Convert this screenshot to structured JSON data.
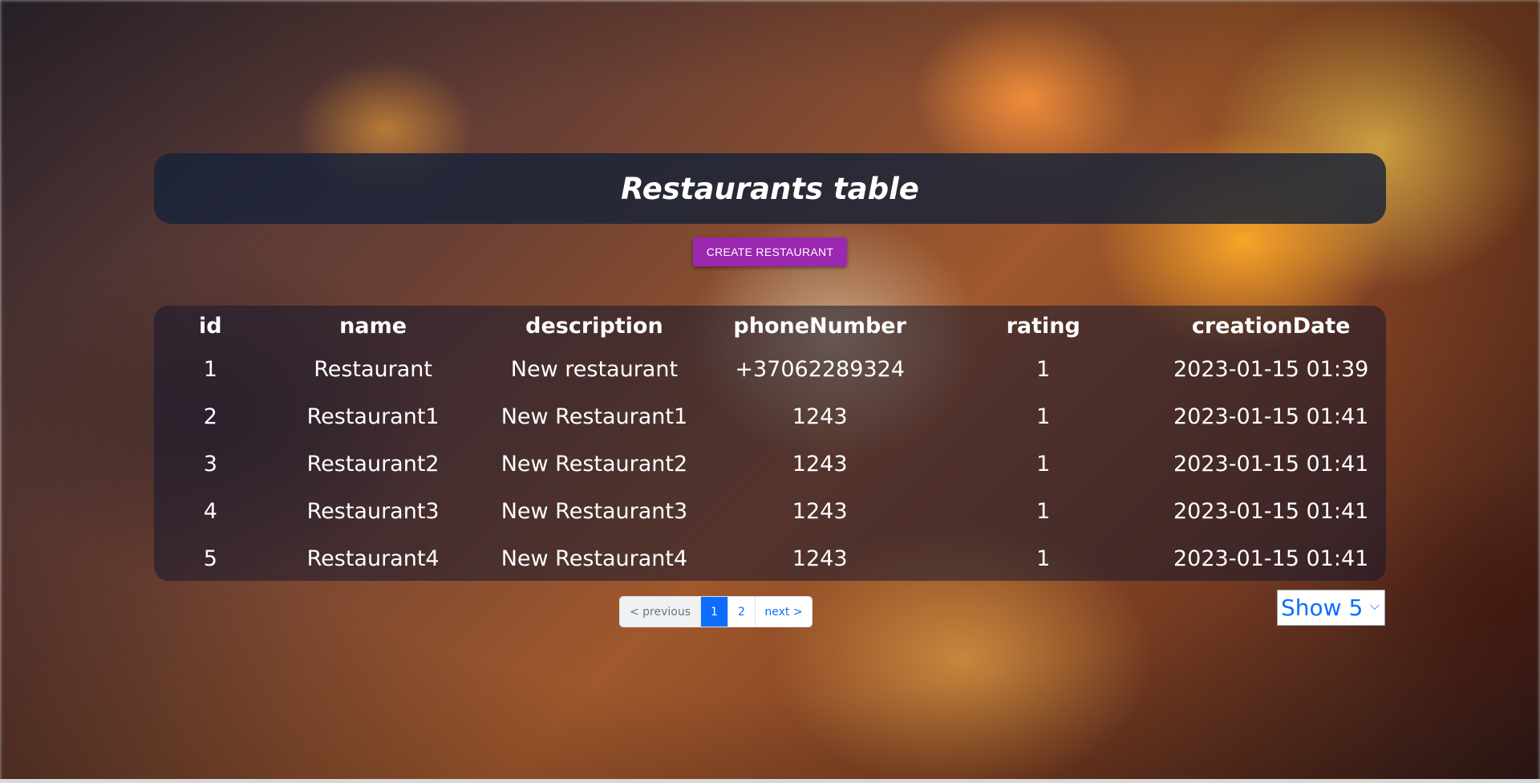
{
  "header": {
    "title": "Restaurants table"
  },
  "actions": {
    "create_label": "CREATE RESTAURANT"
  },
  "table": {
    "columns": [
      "id",
      "name",
      "description",
      "phoneNumber",
      "rating",
      "creationDate"
    ],
    "rows": [
      [
        "1",
        "Restaurant",
        "New restaurant",
        "+37062289324",
        "1",
        "2023-01-15 01:39"
      ],
      [
        "2",
        "Restaurant1",
        "New Restaurant1",
        "1243",
        "1",
        "2023-01-15 01:41"
      ],
      [
        "3",
        "Restaurant2",
        "New Restaurant2",
        "1243",
        "1",
        "2023-01-15 01:41"
      ],
      [
        "4",
        "Restaurant3",
        "New Restaurant3",
        "1243",
        "1",
        "2023-01-15 01:41"
      ],
      [
        "5",
        "Restaurant4",
        "New Restaurant4",
        "1243",
        "1",
        "2023-01-15 01:41"
      ]
    ]
  },
  "pagination": {
    "previous_label": "< previous",
    "pages": [
      "1",
      "2"
    ],
    "active_page": "1",
    "next_label": "next >"
  },
  "page_size": {
    "selected": "Show 5"
  },
  "colors": {
    "accent": "#9c27b0",
    "link": "#0d6efd",
    "header_bg": "#162238"
  }
}
